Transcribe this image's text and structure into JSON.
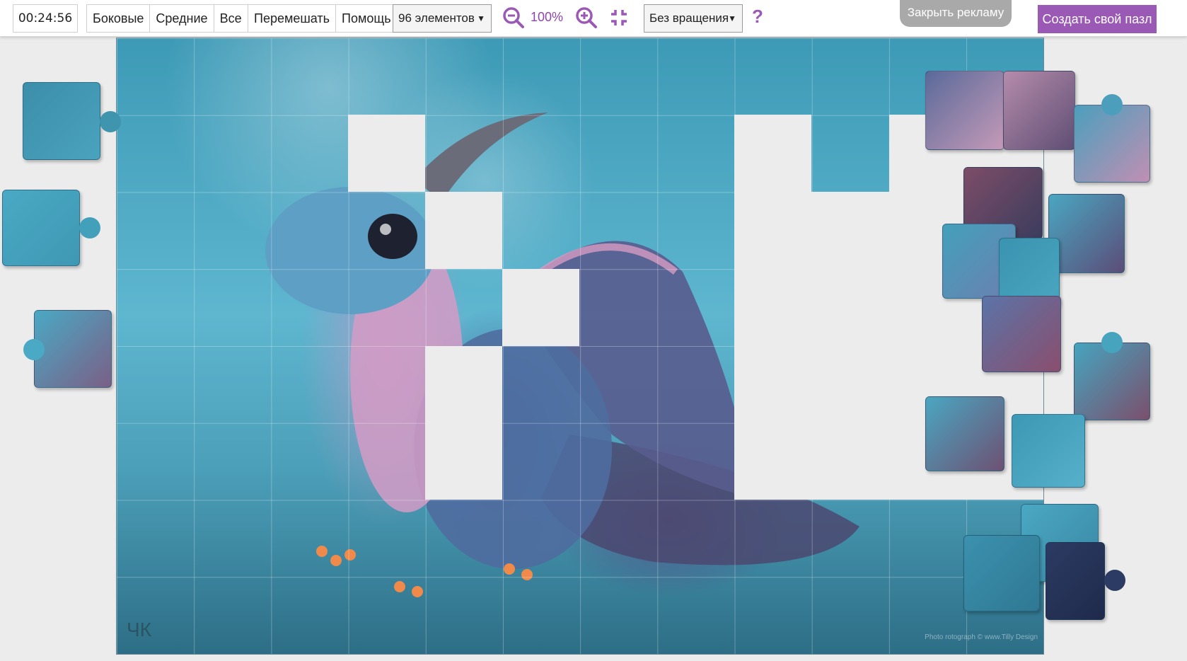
{
  "toolbar": {
    "timer": "00:24:56",
    "edge_filters": [
      "Боковые",
      "Средние",
      "Все"
    ],
    "shuffle_label": "Перемешать",
    "help_label": "Помощь",
    "piece_count": "96 элементов",
    "zoom_value": "100%",
    "rotation": "Без вращения",
    "help_symbol": "?",
    "close_ad_label": "Закрыть рекламу",
    "create_label": "Создать свой пазл"
  },
  "board": {
    "signature": "ЧК",
    "credit": "Photo rotograph © www.Tilly Design"
  },
  "colors": {
    "accent": "#9b59b6",
    "board_bg": "#ececec"
  },
  "icons": [
    "zoom-out-icon",
    "zoom-in-icon",
    "fit-screen-icon",
    "help-icon"
  ]
}
